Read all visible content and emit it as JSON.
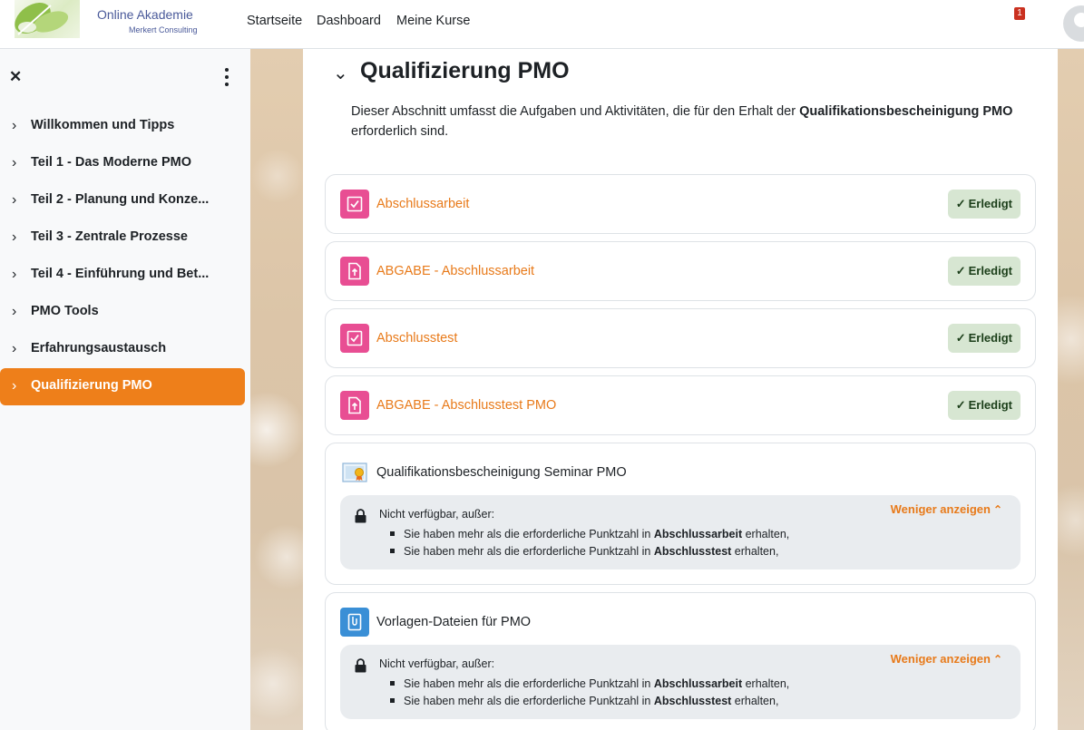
{
  "logo": {
    "title": "Online Akademie",
    "subtitle": "Merkert Consulting"
  },
  "nav": {
    "links": [
      "Startseite",
      "Dashboard",
      "Meine Kurse"
    ],
    "notification_count": "1"
  },
  "drawer": {
    "items": [
      {
        "label": "Willkommen und Tipps",
        "active": false
      },
      {
        "label": "Teil 1 - Das Moderne PMO",
        "active": false
      },
      {
        "label": "Teil 2 - Planung und Konze...",
        "active": false
      },
      {
        "label": "Teil 3 - Zentrale Prozesse",
        "active": false
      },
      {
        "label": "Teil 4 - Einführung und Bet...",
        "active": false
      },
      {
        "label": "PMO Tools",
        "active": false
      },
      {
        "label": "Erfahrungsaustausch",
        "active": false
      },
      {
        "label": "Qualifizierung PMO",
        "active": true
      }
    ]
  },
  "section": {
    "title": "Qualifizierung PMO",
    "desc_before": "Dieser Abschnitt umfasst die Aufgaben und Aktivitäten, die für den Erhalt der ",
    "desc_bold": "Qualifikationsbescheinigung PMO",
    "desc_after": " erforderlich sind."
  },
  "activities": [
    {
      "name": "Abschlussarbeit",
      "icon": "quiz-icon",
      "status": "Erledigt"
    },
    {
      "name": "ABGABE - Abschlussarbeit",
      "icon": "assignment-icon",
      "status": "Erledigt"
    },
    {
      "name": "Abschlusstest",
      "icon": "quiz-icon",
      "status": "Erledigt"
    },
    {
      "name": "ABGABE - Abschlusstest PMO",
      "icon": "assignment-icon",
      "status": "Erledigt"
    }
  ],
  "restricted": [
    {
      "name": "Qualifikationsbescheinigung Seminar PMO",
      "icon": "certificate-icon",
      "heading": "Nicht verfügbar, außer:",
      "toggle": "Weniger anzeigen",
      "conditions": [
        {
          "before": "Sie haben mehr als die erforderliche Punktzahl in ",
          "bold": "Abschlussarbeit",
          "after": " erhalten,"
        },
        {
          "before": "Sie haben mehr als die erforderliche Punktzahl in ",
          "bold": "Abschlusstest",
          "after": " erhalten,"
        }
      ]
    },
    {
      "name": "Vorlagen-Dateien für PMO",
      "icon": "folder-file-icon",
      "heading": "Nicht verfügbar, außer:",
      "toggle": "Weniger anzeigen",
      "conditions": [
        {
          "before": "Sie haben mehr als die erforderliche Punktzahl in ",
          "bold": "Abschlussarbeit",
          "after": " erhalten,"
        },
        {
          "before": "Sie haben mehr als die erforderliche Punktzahl in ",
          "bold": "Abschlusstest",
          "after": " erhalten,"
        }
      ]
    }
  ],
  "colors": {
    "accent": "#ee7f1a",
    "link": "#e87a1a",
    "done_bg": "#d7e6d2",
    "activity_pink": "#e84e93"
  }
}
